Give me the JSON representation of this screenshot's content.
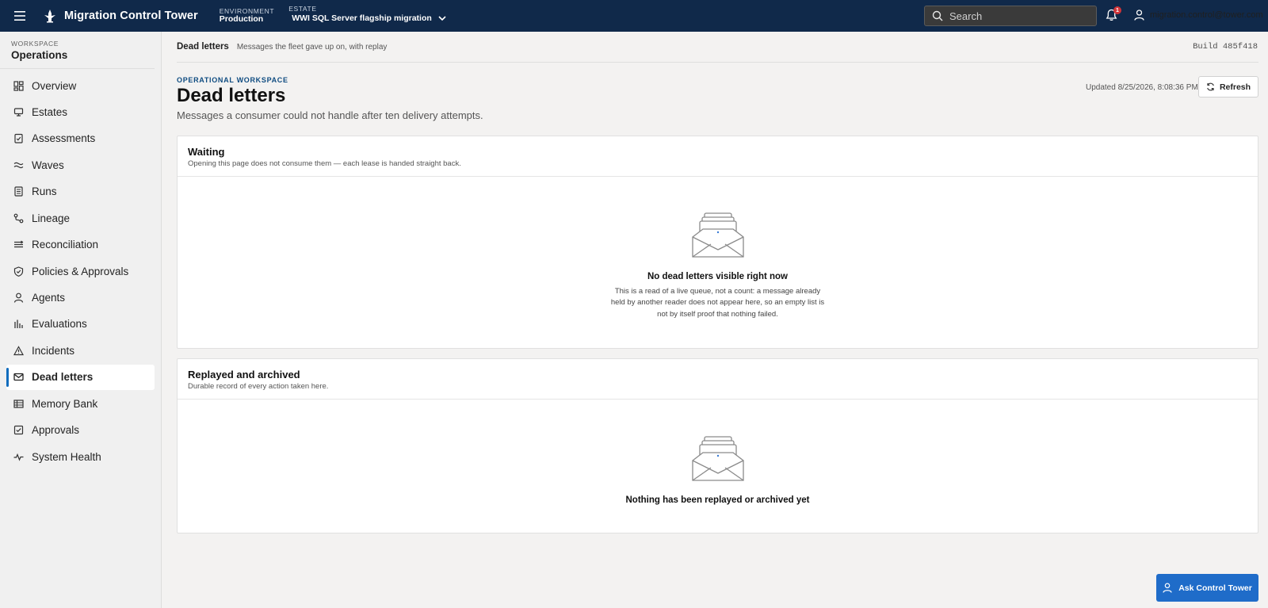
{
  "topbar": {
    "app_title": "Migration Control Tower",
    "environment_label": "ENVIRONMENT",
    "environment_value": "Production",
    "estate_label": "ESTATE",
    "estate_value": "WWI SQL Server flagship migration",
    "search_placeholder": "Search",
    "notification_count": "1",
    "user_email": "migration.control@tower.com"
  },
  "sidebar": {
    "workspace_label": "WORKSPACE",
    "workspace_name": "Operations",
    "items": [
      {
        "label": "Overview",
        "icon": "dashboard-icon"
      },
      {
        "label": "Estates",
        "icon": "server-icon"
      },
      {
        "label": "Assessments",
        "icon": "clipboard-check-icon"
      },
      {
        "label": "Waves",
        "icon": "waves-icon"
      },
      {
        "label": "Runs",
        "icon": "document-list-icon"
      },
      {
        "label": "Lineage",
        "icon": "lineage-icon"
      },
      {
        "label": "Reconciliation",
        "icon": "reconcile-icon"
      },
      {
        "label": "Policies & Approvals",
        "icon": "shield-check-icon"
      },
      {
        "label": "Agents",
        "icon": "person-icon"
      },
      {
        "label": "Evaluations",
        "icon": "bar-chart-icon"
      },
      {
        "label": "Incidents",
        "icon": "warning-icon"
      },
      {
        "label": "Dead letters",
        "icon": "mail-icon",
        "active": true
      },
      {
        "label": "Memory Bank",
        "icon": "table-icon"
      },
      {
        "label": "Approvals",
        "icon": "checkbox-icon"
      },
      {
        "label": "System Health",
        "icon": "pulse-icon"
      }
    ]
  },
  "header": {
    "crumb_title": "Dead letters",
    "crumb_subtitle": "Messages the fleet gave up on, with replay",
    "build": "Build 485f418"
  },
  "page": {
    "eyebrow": "OPERATIONAL WORKSPACE",
    "title": "Dead letters",
    "subtitle": "Messages a consumer could not handle after ten delivery attempts.",
    "updated": "Updated 8/25/2026, 8:08:36 PM",
    "refresh_label": "Refresh"
  },
  "waiting": {
    "title": "Waiting",
    "subtitle": "Opening this page does not consume them — each lease is handed straight back.",
    "empty_title": "No dead letters visible right now",
    "empty_desc": "This is a read of a live queue, not a count: a message already held by another reader does not appear here, so an empty list is not by itself proof that nothing failed."
  },
  "archived": {
    "title": "Replayed and archived",
    "subtitle": "Durable record of every action taken here.",
    "empty_title": "Nothing has been replayed or archived yet"
  },
  "assistant": {
    "label": "Ask Control Tower"
  },
  "colors": {
    "topbar": "#10294a",
    "accent": "#0f6cbd",
    "assistant_button": "#1f6cc9",
    "badge": "#d13438"
  }
}
